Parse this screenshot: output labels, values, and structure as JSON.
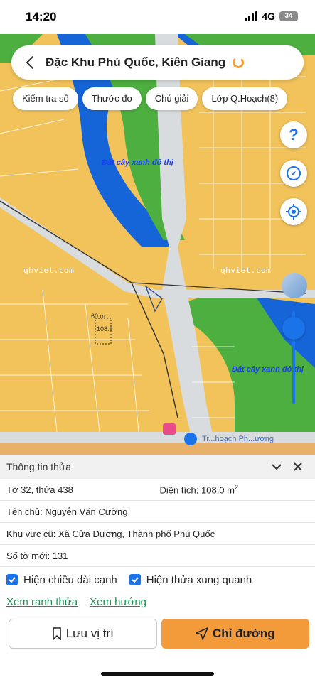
{
  "status": {
    "time": "14:20",
    "network": "4G",
    "battery": "34"
  },
  "search": {
    "title": "Đặc Khu Phú Quốc, Kiên Giang"
  },
  "chips": [
    "Kiểm tra số",
    "Thước đo",
    "Chú giải",
    "Lớp Q.Hoạch(8)"
  ],
  "map": {
    "zone_label_1": "Đất cây xanh đô thị",
    "zone_label_2": "Đất cây xanh đô thị",
    "watermark_1": "qhviet.com",
    "watermark_2": "qhviet.com",
    "parcel_dims": "60 m",
    "parcel_number": "108.0",
    "poi_bottom": "Tr...hoạch Ph...ương",
    "colors": {
      "land": "#f2c35b",
      "green": "#4caf3f",
      "water": "#1565d8",
      "road": "#dcdcdc",
      "accent": "#1a73e8"
    }
  },
  "panel": {
    "title": "Thông tin thửa",
    "sheet_parcel": "Tờ 32, thửa 438",
    "area_label": "Diện tích: 108.0 m",
    "area_sup": "2",
    "owner": "Tên chủ: Nguyễn Văn Cường",
    "old_area": "Khu vực cũ: Xã Cửa Dương, Thành phố Phú Quốc",
    "new_sheet": "Số tờ mới: 131",
    "check_edges": "Hiện chiều dài cạnh",
    "check_neighbors": "Hiện thửa xung quanh",
    "link_boundary": "Xem ranh thửa",
    "link_direction": "Xem hướng",
    "save_label": "Lưu vị trí",
    "route_label": "Chỉ đường"
  }
}
